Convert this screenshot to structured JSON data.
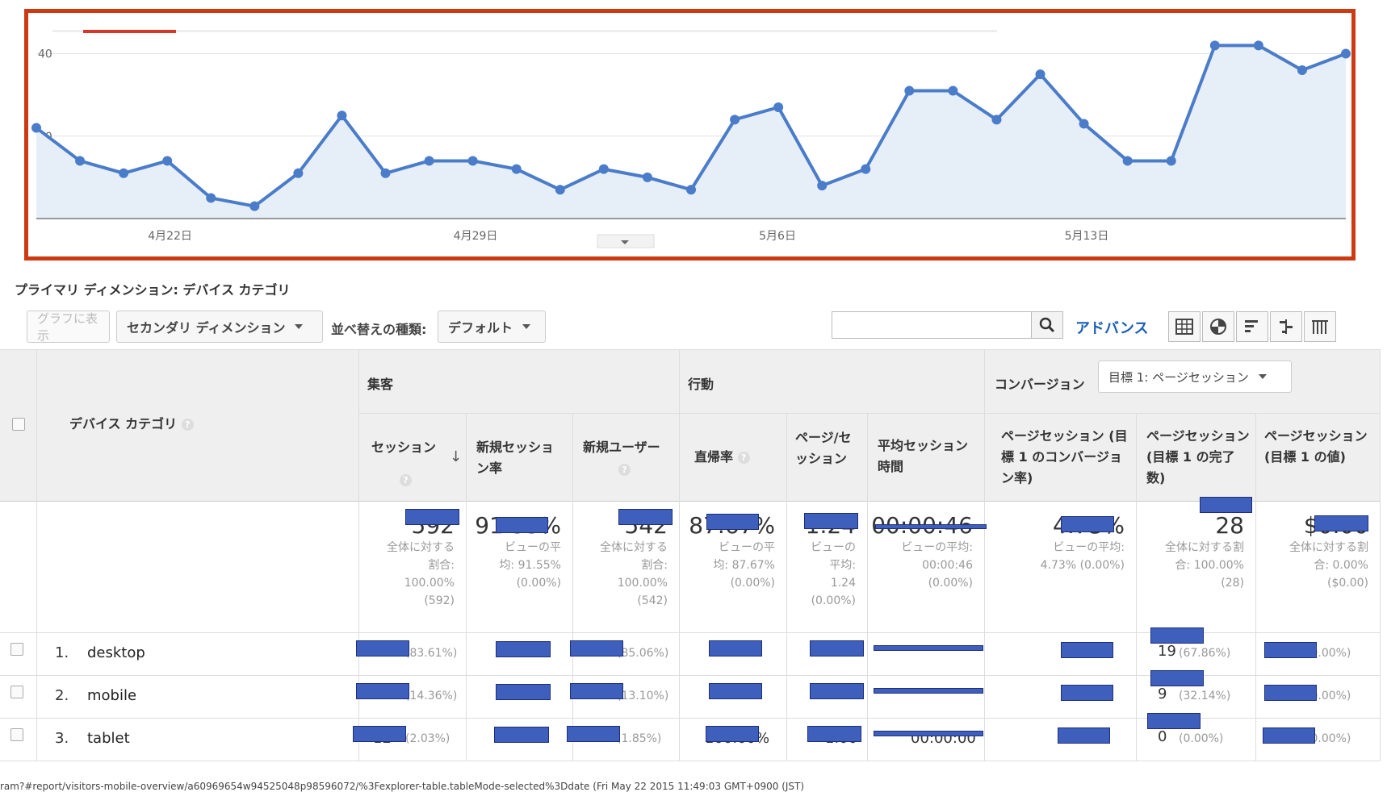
{
  "chart": {
    "y_labels": [
      "40",
      "20"
    ],
    "x_labels": [
      "4月22日",
      "4月29日",
      "5月6日",
      "5月13日"
    ],
    "line_color": "#4a7cc9",
    "fill_color": "#e6eef8",
    "frame_color": "#cc3a12"
  },
  "chart_data": {
    "type": "area",
    "x": [
      "4/19",
      "4/20",
      "4/21",
      "4/22",
      "4/23",
      "4/24",
      "4/25",
      "4/26",
      "4/27",
      "4/28",
      "4/29",
      "4/30",
      "5/1",
      "5/2",
      "5/3",
      "5/4",
      "5/5",
      "5/6",
      "5/7",
      "5/8",
      "5/9",
      "5/10",
      "5/11",
      "5/12",
      "5/13",
      "5/14",
      "5/15",
      "5/16",
      "5/17",
      "5/18",
      "5/19",
      "5/20"
    ],
    "values": [
      22,
      14,
      11,
      14,
      5,
      3,
      11,
      25,
      11,
      14,
      14,
      12,
      7,
      12,
      10,
      7,
      24,
      27,
      8,
      12,
      31,
      31,
      24,
      35,
      23,
      14,
      14,
      42,
      42,
      36,
      40
    ],
    "x_tick_labels": [
      "4月22日",
      "4月29日",
      "5月6日",
      "5月13日"
    ],
    "y_tick_labels": [
      "40",
      "20"
    ],
    "ylim": [
      0,
      45
    ],
    "grid": true
  },
  "toolbar": {
    "primary_dimension": "プライマリ ディメンション:  デバイス カテゴリ",
    "show_graph": "グラフに表示",
    "secondary_dimension": "セカンダリ ディメンション",
    "sort_type_label": "並べ替えの種類:",
    "sort_default": "デフォルト",
    "search_value": "",
    "advanced": "アドバンス",
    "view_icons": [
      "table-icon",
      "pie-icon",
      "bar-icon",
      "comparison-icon",
      "pivot-icon"
    ]
  },
  "table": {
    "dim_header": "デバイス カテゴリ",
    "groups": {
      "acquisition": "集客",
      "behavior": "行動",
      "conversion": "コンバージョン",
      "goal_select": "目標 1: ページセッション"
    },
    "columns": [
      "セッション",
      "新規セッション率",
      "新規ユーザー",
      "直帰率",
      "ページ/セッション",
      "平均セッション時間",
      "ページセッション (目標 1 のコンバージョン率)",
      "ページセッション (目標 1 の完了数)",
      "ページセッション (目標 1 の値)"
    ],
    "totals": {
      "sessions": "592",
      "sessions_sub": [
        "全体に対する",
        "割合:",
        "100.00%",
        "(592)"
      ],
      "new_rate": "91.55%",
      "new_rate_sub": [
        "ビューの平",
        "均: 91.55%",
        "(0.00%)"
      ],
      "new_users": "542",
      "new_users_sub": [
        "全体に対する",
        "割合:",
        "100.00%",
        "(542)"
      ],
      "bounce": "87.67%",
      "bounce_sub": [
        "ビューの平",
        "均: 87.67%",
        "(0.00%)"
      ],
      "pps": "1.24",
      "pps_sub": [
        "ビューの",
        "平均:",
        "1.24",
        "(0.00%)"
      ],
      "duration": "00:00:46",
      "duration_sub": [
        "ビューの平均:",
        "00:00:46",
        "(0.00%)"
      ],
      "conv_rate": "4.73%",
      "conv_rate_sub": [
        "ビューの平均:",
        "4.73% (0.00%)"
      ],
      "completions": "28",
      "completions_sub": [
        "全体に対する割",
        "合: 100.00%",
        "(28)"
      ],
      "value": "$0.00",
      "value_sub": [
        "全体に対する割",
        "合: 0.00%",
        "($0.00)"
      ]
    },
    "rows": [
      {
        "idx": "1.",
        "name": "desktop",
        "sessions_pct": "(83.61%)",
        "new_users_pct": "(85.06%)",
        "completions": "19",
        "completions_pct": "(67.86%)",
        "value_pct": "(0.00%)"
      },
      {
        "idx": "2.",
        "name": "mobile",
        "sessions_pct": "(14.36%)",
        "new_users_pct": "(13.10%)",
        "completions": "9",
        "completions_pct": "(32.14%)",
        "value_pct": "(0.00%)"
      },
      {
        "idx": "3.",
        "name": "tablet",
        "sessions_pct": "(2.03%)",
        "new_users_pct": "(1.85%)",
        "completions": "0",
        "completions_pct": "(0.00%)",
        "value_pct": "(0.00%)",
        "sessions": "12",
        "bounce": "100.00%",
        "pps": "1.00",
        "duration": "00:00:00"
      }
    ]
  },
  "footer": {
    "url": "ram?#report/visitors-mobile-overview/a60969654w94525048p98596072/%3Fexplorer-table.tableMode-selected%3Ddate (Fri May 22 2015 11:49:03 GMT+0900 (JST)"
  }
}
